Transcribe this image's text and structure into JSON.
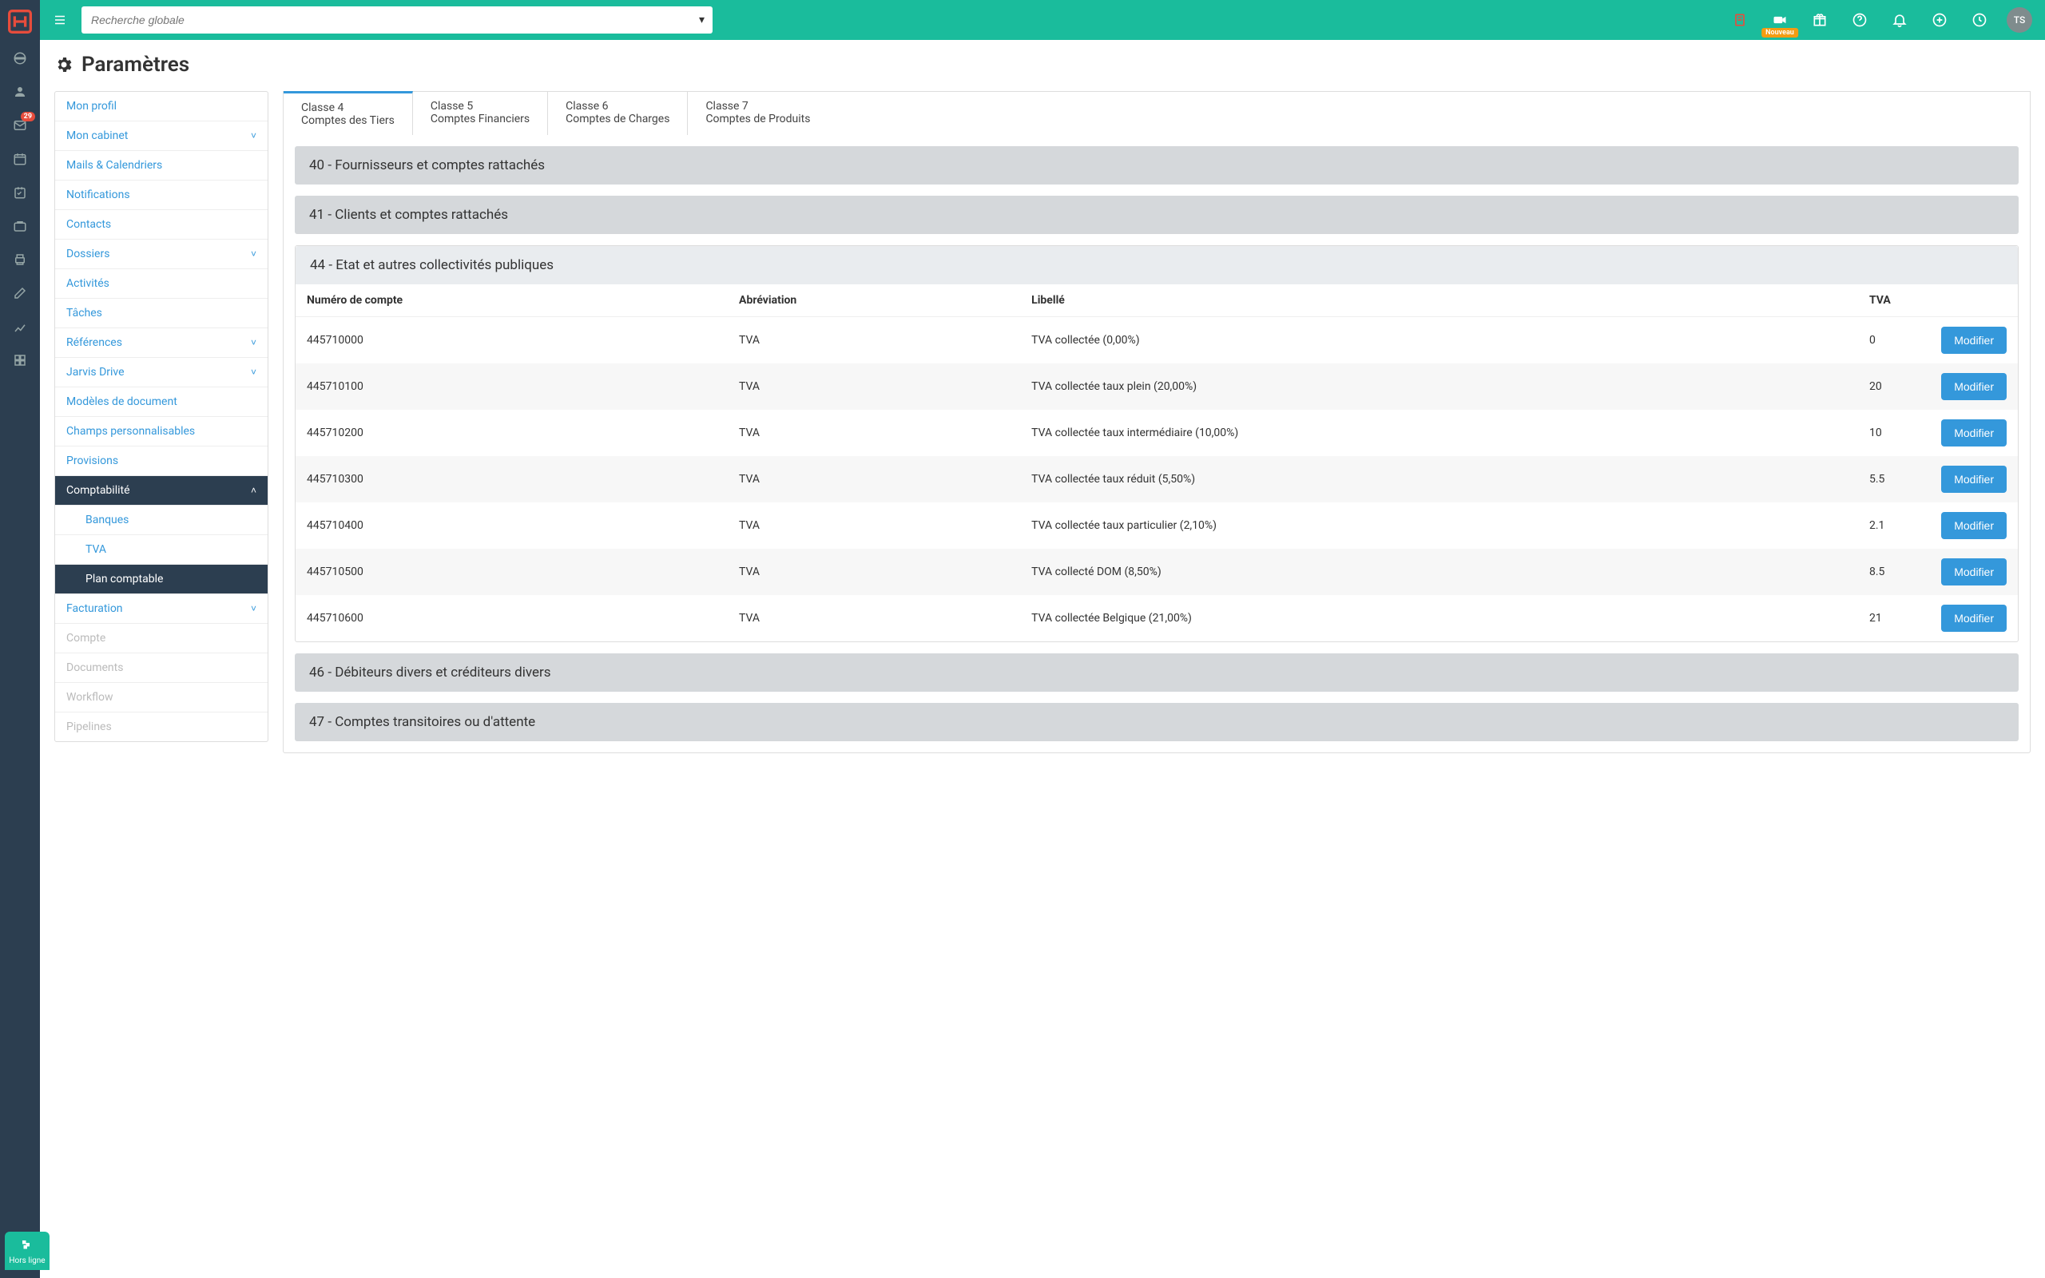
{
  "header": {
    "global_search_placeholder": "Recherche globale",
    "mail_badge": "29",
    "video_badge": "Nouveau",
    "avatar_initials": "TS"
  },
  "page_title": "Paramètres",
  "offline_label": "Hors ligne",
  "sidemenu": [
    {
      "label": "Mon profil"
    },
    {
      "label": "Mon cabinet",
      "chevron": true
    },
    {
      "label": "Mails & Calendriers"
    },
    {
      "label": "Notifications"
    },
    {
      "label": "Contacts"
    },
    {
      "label": "Dossiers",
      "chevron": true
    },
    {
      "label": "Activités"
    },
    {
      "label": "Tâches"
    },
    {
      "label": "Références",
      "chevron": true
    },
    {
      "label": "Jarvis Drive",
      "chevron": true
    },
    {
      "label": "Modèles de document"
    },
    {
      "label": "Champs personnalisables"
    },
    {
      "label": "Provisions"
    },
    {
      "label": "Comptabilité",
      "active": true,
      "chevron_up": true
    },
    {
      "label": "Banques",
      "sub": true
    },
    {
      "label": "TVA",
      "sub": true
    },
    {
      "label": "Plan comptable",
      "sub": true,
      "active": true
    },
    {
      "label": "Facturation",
      "chevron": true
    },
    {
      "label": "Compte",
      "disabled": true
    },
    {
      "label": "Documents",
      "disabled": true
    },
    {
      "label": "Workflow",
      "disabled": true
    },
    {
      "label": "Pipelines",
      "disabled": true
    }
  ],
  "tabs": [
    {
      "l1": "Classe 4",
      "l2": "Comptes des Tiers",
      "active": true
    },
    {
      "l1": "Classe 5",
      "l2": "Comptes Financiers"
    },
    {
      "l1": "Classe 6",
      "l2": "Comptes de Charges"
    },
    {
      "l1": "Classe 7",
      "l2": "Comptes de Produits"
    }
  ],
  "sections": {
    "s40": "40 - Fournisseurs et comptes rattachés",
    "s41": "41 - Clients et comptes rattachés",
    "s44": "44 - Etat et autres collectivités publiques",
    "s46": "46 - Débiteurs divers et créditeurs divers",
    "s47": "47 - Comptes transitoires ou d'attente"
  },
  "table": {
    "headers": {
      "num": "Numéro de compte",
      "abrev": "Abréviation",
      "libelle": "Libellé",
      "tva": "TVA"
    },
    "modify_label": "Modifier",
    "rows": [
      {
        "num": "445710000",
        "abrev": "TVA",
        "libelle": "TVA collectée (0,00%)",
        "tva": "0"
      },
      {
        "num": "445710100",
        "abrev": "TVA",
        "libelle": "TVA collectée taux plein (20,00%)",
        "tva": "20"
      },
      {
        "num": "445710200",
        "abrev": "TVA",
        "libelle": "TVA collectée taux intermédiaire (10,00%)",
        "tva": "10"
      },
      {
        "num": "445710300",
        "abrev": "TVA",
        "libelle": "TVA collectée taux réduit (5,50%)",
        "tva": "5.5"
      },
      {
        "num": "445710400",
        "abrev": "TVA",
        "libelle": "TVA collectée taux particulier (2,10%)",
        "tva": "2.1"
      },
      {
        "num": "445710500",
        "abrev": "TVA",
        "libelle": "TVA collecté DOM (8,50%)",
        "tva": "8.5"
      },
      {
        "num": "445710600",
        "abrev": "TVA",
        "libelle": "TVA collectée Belgique (21,00%)",
        "tva": "21"
      }
    ]
  },
  "colors": {
    "accent": "#1abc9c",
    "primary": "#3498db",
    "dark": "#2c3e50"
  }
}
